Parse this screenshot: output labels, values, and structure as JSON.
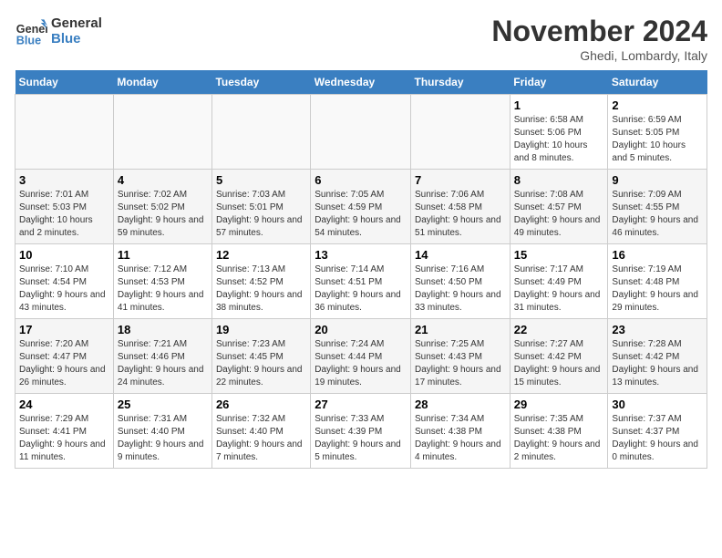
{
  "header": {
    "logo_line1": "General",
    "logo_line2": "Blue",
    "month_title": "November 2024",
    "subtitle": "Ghedi, Lombardy, Italy"
  },
  "days_of_week": [
    "Sunday",
    "Monday",
    "Tuesday",
    "Wednesday",
    "Thursday",
    "Friday",
    "Saturday"
  ],
  "weeks": [
    [
      {
        "day": "",
        "info": ""
      },
      {
        "day": "",
        "info": ""
      },
      {
        "day": "",
        "info": ""
      },
      {
        "day": "",
        "info": ""
      },
      {
        "day": "",
        "info": ""
      },
      {
        "day": "1",
        "info": "Sunrise: 6:58 AM\nSunset: 5:06 PM\nDaylight: 10 hours and 8 minutes."
      },
      {
        "day": "2",
        "info": "Sunrise: 6:59 AM\nSunset: 5:05 PM\nDaylight: 10 hours and 5 minutes."
      }
    ],
    [
      {
        "day": "3",
        "info": "Sunrise: 7:01 AM\nSunset: 5:03 PM\nDaylight: 10 hours and 2 minutes."
      },
      {
        "day": "4",
        "info": "Sunrise: 7:02 AM\nSunset: 5:02 PM\nDaylight: 9 hours and 59 minutes."
      },
      {
        "day": "5",
        "info": "Sunrise: 7:03 AM\nSunset: 5:01 PM\nDaylight: 9 hours and 57 minutes."
      },
      {
        "day": "6",
        "info": "Sunrise: 7:05 AM\nSunset: 4:59 PM\nDaylight: 9 hours and 54 minutes."
      },
      {
        "day": "7",
        "info": "Sunrise: 7:06 AM\nSunset: 4:58 PM\nDaylight: 9 hours and 51 minutes."
      },
      {
        "day": "8",
        "info": "Sunrise: 7:08 AM\nSunset: 4:57 PM\nDaylight: 9 hours and 49 minutes."
      },
      {
        "day": "9",
        "info": "Sunrise: 7:09 AM\nSunset: 4:55 PM\nDaylight: 9 hours and 46 minutes."
      }
    ],
    [
      {
        "day": "10",
        "info": "Sunrise: 7:10 AM\nSunset: 4:54 PM\nDaylight: 9 hours and 43 minutes."
      },
      {
        "day": "11",
        "info": "Sunrise: 7:12 AM\nSunset: 4:53 PM\nDaylight: 9 hours and 41 minutes."
      },
      {
        "day": "12",
        "info": "Sunrise: 7:13 AM\nSunset: 4:52 PM\nDaylight: 9 hours and 38 minutes."
      },
      {
        "day": "13",
        "info": "Sunrise: 7:14 AM\nSunset: 4:51 PM\nDaylight: 9 hours and 36 minutes."
      },
      {
        "day": "14",
        "info": "Sunrise: 7:16 AM\nSunset: 4:50 PM\nDaylight: 9 hours and 33 minutes."
      },
      {
        "day": "15",
        "info": "Sunrise: 7:17 AM\nSunset: 4:49 PM\nDaylight: 9 hours and 31 minutes."
      },
      {
        "day": "16",
        "info": "Sunrise: 7:19 AM\nSunset: 4:48 PM\nDaylight: 9 hours and 29 minutes."
      }
    ],
    [
      {
        "day": "17",
        "info": "Sunrise: 7:20 AM\nSunset: 4:47 PM\nDaylight: 9 hours and 26 minutes."
      },
      {
        "day": "18",
        "info": "Sunrise: 7:21 AM\nSunset: 4:46 PM\nDaylight: 9 hours and 24 minutes."
      },
      {
        "day": "19",
        "info": "Sunrise: 7:23 AM\nSunset: 4:45 PM\nDaylight: 9 hours and 22 minutes."
      },
      {
        "day": "20",
        "info": "Sunrise: 7:24 AM\nSunset: 4:44 PM\nDaylight: 9 hours and 19 minutes."
      },
      {
        "day": "21",
        "info": "Sunrise: 7:25 AM\nSunset: 4:43 PM\nDaylight: 9 hours and 17 minutes."
      },
      {
        "day": "22",
        "info": "Sunrise: 7:27 AM\nSunset: 4:42 PM\nDaylight: 9 hours and 15 minutes."
      },
      {
        "day": "23",
        "info": "Sunrise: 7:28 AM\nSunset: 4:42 PM\nDaylight: 9 hours and 13 minutes."
      }
    ],
    [
      {
        "day": "24",
        "info": "Sunrise: 7:29 AM\nSunset: 4:41 PM\nDaylight: 9 hours and 11 minutes."
      },
      {
        "day": "25",
        "info": "Sunrise: 7:31 AM\nSunset: 4:40 PM\nDaylight: 9 hours and 9 minutes."
      },
      {
        "day": "26",
        "info": "Sunrise: 7:32 AM\nSunset: 4:40 PM\nDaylight: 9 hours and 7 minutes."
      },
      {
        "day": "27",
        "info": "Sunrise: 7:33 AM\nSunset: 4:39 PM\nDaylight: 9 hours and 5 minutes."
      },
      {
        "day": "28",
        "info": "Sunrise: 7:34 AM\nSunset: 4:38 PM\nDaylight: 9 hours and 4 minutes."
      },
      {
        "day": "29",
        "info": "Sunrise: 7:35 AM\nSunset: 4:38 PM\nDaylight: 9 hours and 2 minutes."
      },
      {
        "day": "30",
        "info": "Sunrise: 7:37 AM\nSunset: 4:37 PM\nDaylight: 9 hours and 0 minutes."
      }
    ]
  ]
}
